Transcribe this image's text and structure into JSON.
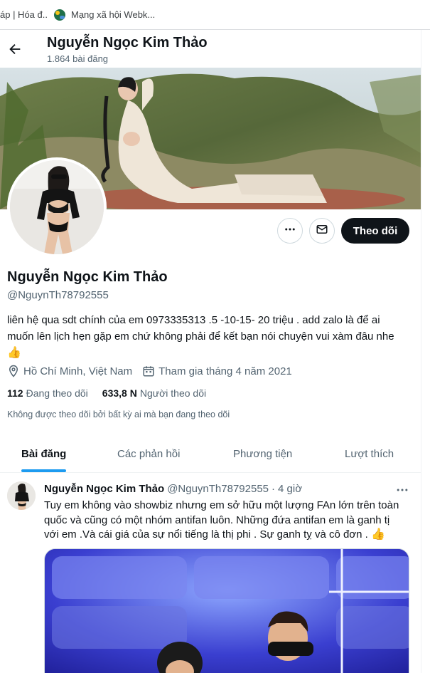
{
  "browser": {
    "bookmarks": [
      {
        "label": "áp | Hóa đ..."
      },
      {
        "label": "Mạng xã hội Webk...",
        "icon": "site-favicon"
      }
    ]
  },
  "header": {
    "title": "Nguyễn Ngọc Kim Thảo",
    "post_count": "1.864 bài đăng",
    "back_icon": "arrow-left-icon"
  },
  "profile": {
    "name": "Nguyễn Ngọc Kim Thảo",
    "handle": "@NguynTh78792555",
    "bio": "liên hệ qua sdt chính của em 0973335313 .5 -10-15- 20 triệu . add zalo là để ai muốn lên lịch hẹn gặp em chứ không phải để kết bạn nói chuyện vui xàm đâu nhe",
    "bio_emoji": "👍",
    "location": "Hồ Chí Minh, Việt Nam",
    "joined": "Tham gia tháng 4 năm 2021",
    "following_count": "112",
    "following_label": "Đang theo dõi",
    "followers_count": "633,8 N",
    "followers_label": "Người theo dõi",
    "not_followed_text": "Không được theo dõi bởi bất kỳ ai mà bạn đang theo dõi"
  },
  "actions": {
    "more_icon": "more-horizontal-icon",
    "message_icon": "mail-icon",
    "follow_label": "Theo dõi"
  },
  "tabs": [
    {
      "label": "Bài đăng",
      "active": true
    },
    {
      "label": "Các phản hồi",
      "active": false
    },
    {
      "label": "Phương tiện",
      "active": false
    },
    {
      "label": "Lượt thích",
      "active": false
    }
  ],
  "post": {
    "author": "Nguyễn Ngọc Kim Thảo",
    "handle": "@NguynTh78792555",
    "separator": "·",
    "time": "4 giờ",
    "text": "Tuy em không vào showbiz nhưng em sở hữu một lượng FAn lớn trên toàn quốc và cũng có một nhóm antifan luôn. Những đứa antifan em là ganh tị với em  .Và cái giá của sự nổi tiếng là thị phi . Sự ganh tỵ và cô đơn .",
    "emoji": "👍"
  },
  "colors": {
    "accent": "#1d9bf0",
    "text": "#0f1419",
    "secondary": "#536471",
    "follow_button": "#0f1419"
  }
}
